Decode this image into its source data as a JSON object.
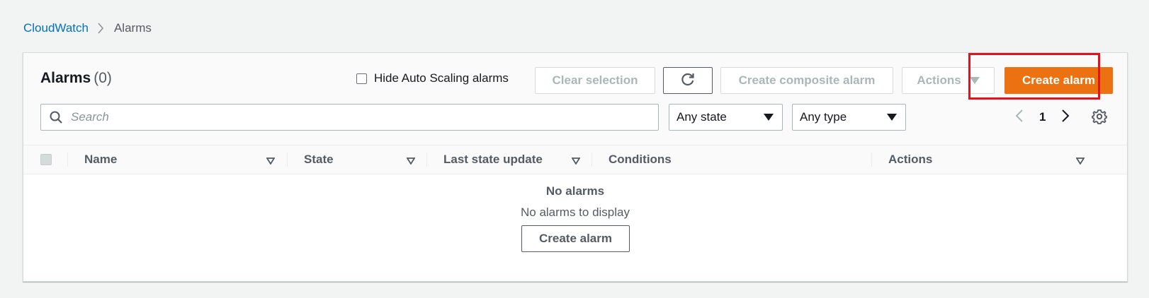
{
  "breadcrumb": {
    "parent": "CloudWatch",
    "current": "Alarms"
  },
  "header": {
    "title": "Alarms",
    "count": "(0)",
    "hide_autoscaling_label": "Hide Auto Scaling alarms",
    "clear_selection_label": "Clear selection",
    "refresh_icon": "refresh-icon",
    "create_composite_label": "Create composite alarm",
    "actions_label": "Actions",
    "create_alarm_label": "Create alarm"
  },
  "filters": {
    "search_placeholder": "Search",
    "state_value": "Any state",
    "type_value": "Any type"
  },
  "pagination": {
    "current_page": "1"
  },
  "table": {
    "columns": [
      "Name",
      "State",
      "Last state update",
      "Conditions",
      "Actions"
    ]
  },
  "empty_state": {
    "title": "No alarms",
    "description": "No alarms to display",
    "button_label": "Create alarm"
  },
  "colors": {
    "primary": "#ec7211",
    "link": "#0073bb",
    "highlight": "#e0131e"
  }
}
